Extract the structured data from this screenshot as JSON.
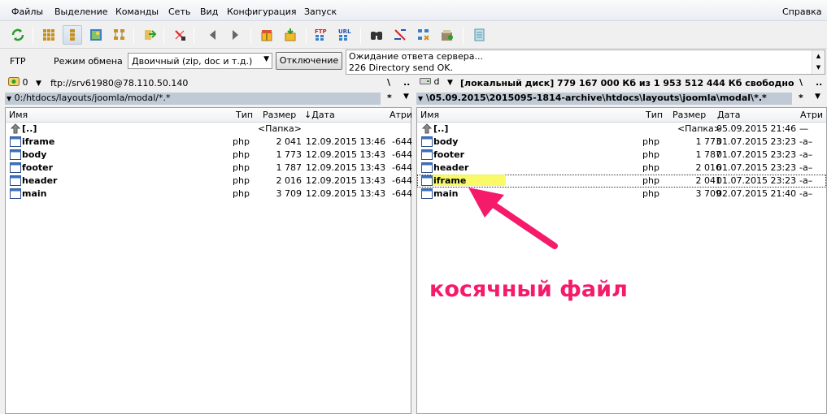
{
  "menu": [
    "Файлы",
    "Выделение",
    "Команды",
    "Сеть",
    "Вид",
    "Конфигурация",
    "Запуск"
  ],
  "help_menu": "Справка",
  "toolbar_icons": [
    "refresh-icon",
    "brief-view-icon",
    "full-view-icon",
    "thumbnail-icon",
    "tree-icon",
    "compare-icon",
    "edit-icon",
    "back-icon",
    "forward-icon",
    "pack-icon",
    "unpack-icon",
    "ftp-connect-icon",
    "url-connect-icon",
    "find-icon",
    "rename-icon",
    "sync-icon",
    "archive-icon",
    "notepad-icon"
  ],
  "ftp": {
    "label": "FTP",
    "mode_label": "Режим обмена",
    "mode_value": "Двоичный (zip, doc и т.д.)",
    "disconnect": "Отключение",
    "log": [
      "Ожидание ответа сервера...",
      "226 Directory send OK."
    ]
  },
  "left": {
    "drive": "0",
    "drive_text": "ftp://srv61980@78.110.50.140",
    "nav_root": "\\",
    "nav_up": "..",
    "path": "0:/htdocs/layouts/joomla/modal/*.*",
    "path_ctl": "*",
    "columns": {
      "name": "Имя",
      "type": "Тип",
      "size": "Размер",
      "date": "Дата",
      "attr": "Атри"
    },
    "sort_indicator": "↓",
    "rows": [
      {
        "name": "[..]",
        "type": "",
        "size": "<Папка>",
        "date": "",
        "attr": ""
      },
      {
        "name": "iframe",
        "type": "php",
        "size": "2 041",
        "date": "12.09.2015 13:46",
        "attr": "-644"
      },
      {
        "name": "body",
        "type": "php",
        "size": "1 773",
        "date": "12.09.2015 13:43",
        "attr": "-644"
      },
      {
        "name": "footer",
        "type": "php",
        "size": "1 787",
        "date": "12.09.2015 13:43",
        "attr": "-644"
      },
      {
        "name": "header",
        "type": "php",
        "size": "2 016",
        "date": "12.09.2015 13:43",
        "attr": "-644"
      },
      {
        "name": "main",
        "type": "php",
        "size": "3 709",
        "date": "12.09.2015 13:43",
        "attr": "-644"
      }
    ]
  },
  "right": {
    "drive": "d",
    "drive_text": "[локальный диск]  779 167 000 Кб из 1 953 512 444 Кб свободно",
    "nav_root": "\\",
    "nav_up": "..",
    "path": "\\05.09.2015\\2015095-1814-archive\\htdocs\\layouts\\joomla\\modal\\*.*",
    "path_ctl": "*",
    "columns": {
      "name": "Имя",
      "type": "Тип",
      "size": "Размер",
      "date": "Дата",
      "attr": "Атри"
    },
    "rows": [
      {
        "name": "[..]",
        "type": "",
        "size": "<Папка>",
        "date": "05.09.2015 21:46",
        "attr": "—"
      },
      {
        "name": "body",
        "type": "php",
        "size": "1 773",
        "date": "01.07.2015 23:23",
        "attr": "-a–"
      },
      {
        "name": "footer",
        "type": "php",
        "size": "1 787",
        "date": "01.07.2015 23:23",
        "attr": "-a–"
      },
      {
        "name": "header",
        "type": "php",
        "size": "2 016",
        "date": "01.07.2015 23:23",
        "attr": "-a–"
      },
      {
        "name": "iframe",
        "type": "php",
        "size": "2 041",
        "date": "01.07.2015 23:23",
        "attr": "-a–"
      },
      {
        "name": "main",
        "type": "php",
        "size": "3 709",
        "date": "02.07.2015 21:40",
        "attr": "-a–"
      }
    ]
  },
  "annotation": "косячный файл",
  "colors": {
    "accent_path": "#c0cad6",
    "annotation": "#f51b6a",
    "highlight": "#f8f85a"
  }
}
